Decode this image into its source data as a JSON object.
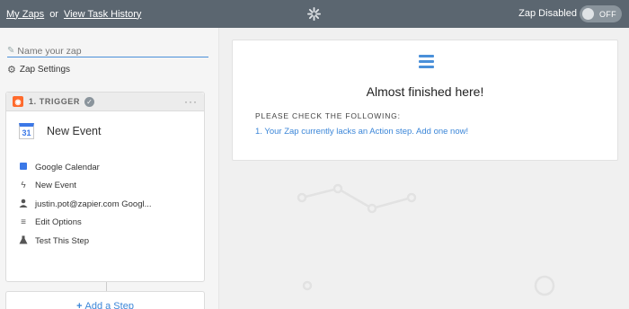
{
  "topbar": {
    "my_zaps": "My Zaps",
    "or": "or",
    "task_history": "View Task History",
    "status": "Zap Disabled",
    "toggle_label": "OFF"
  },
  "left": {
    "name_placeholder": "Name your zap",
    "zap_settings": "Zap Settings",
    "trigger": {
      "label": "1. TRIGGER",
      "event_name": "New Event",
      "calendar_day": "31",
      "items": [
        {
          "icon": "google-calendar-icon",
          "label": "Google Calendar"
        },
        {
          "icon": "lightning-icon",
          "label": "New Event"
        },
        {
          "icon": "user-icon",
          "label": "justin.pot@zapier.com Googl..."
        },
        {
          "icon": "lines-icon",
          "label": "Edit Options"
        },
        {
          "icon": "flask-icon",
          "label": "Test This Step"
        }
      ]
    },
    "add_step": "Add a Step"
  },
  "card": {
    "title": "Almost finished here!",
    "check_heading": "PLEASE CHECK THE FOLLOWING:",
    "message": "1. Your Zap currently lacks an Action step. Add one now!"
  },
  "colors": {
    "topbar": "#5b6670",
    "accent": "#3b86d8",
    "trigger_icon": "#ff6a2c"
  }
}
